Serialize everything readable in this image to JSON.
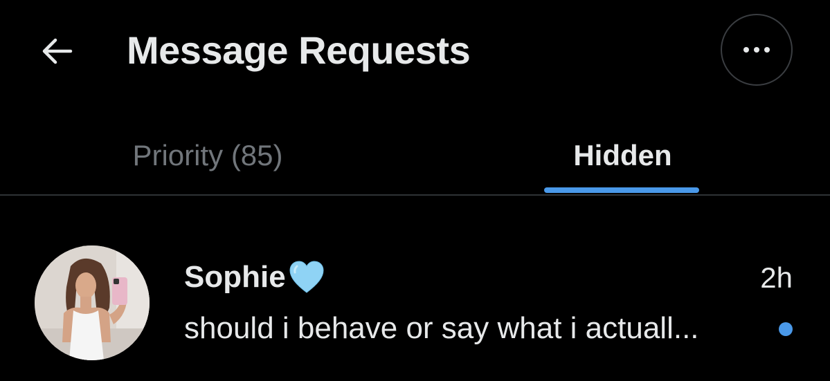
{
  "header": {
    "title": "Message Requests",
    "back_icon": "arrow-left-icon",
    "more_icon": "ellipsis-horizontal-icon"
  },
  "tabs": [
    {
      "label": "Priority (85)",
      "active": false
    },
    {
      "label": "Hidden",
      "active": true
    }
  ],
  "colors": {
    "background": "#000000",
    "accent": "#4a99e9",
    "primary_text": "#e7e9ea",
    "secondary_text": "#71767b",
    "divider": "#2f3336"
  },
  "conversations": [
    {
      "name": "Sophie",
      "name_emoji": "light-blue-heart-icon",
      "time": "2h",
      "preview": "should i behave or say what i actuall...",
      "unread": true,
      "avatar_icon": "user-avatar-photo"
    }
  ]
}
